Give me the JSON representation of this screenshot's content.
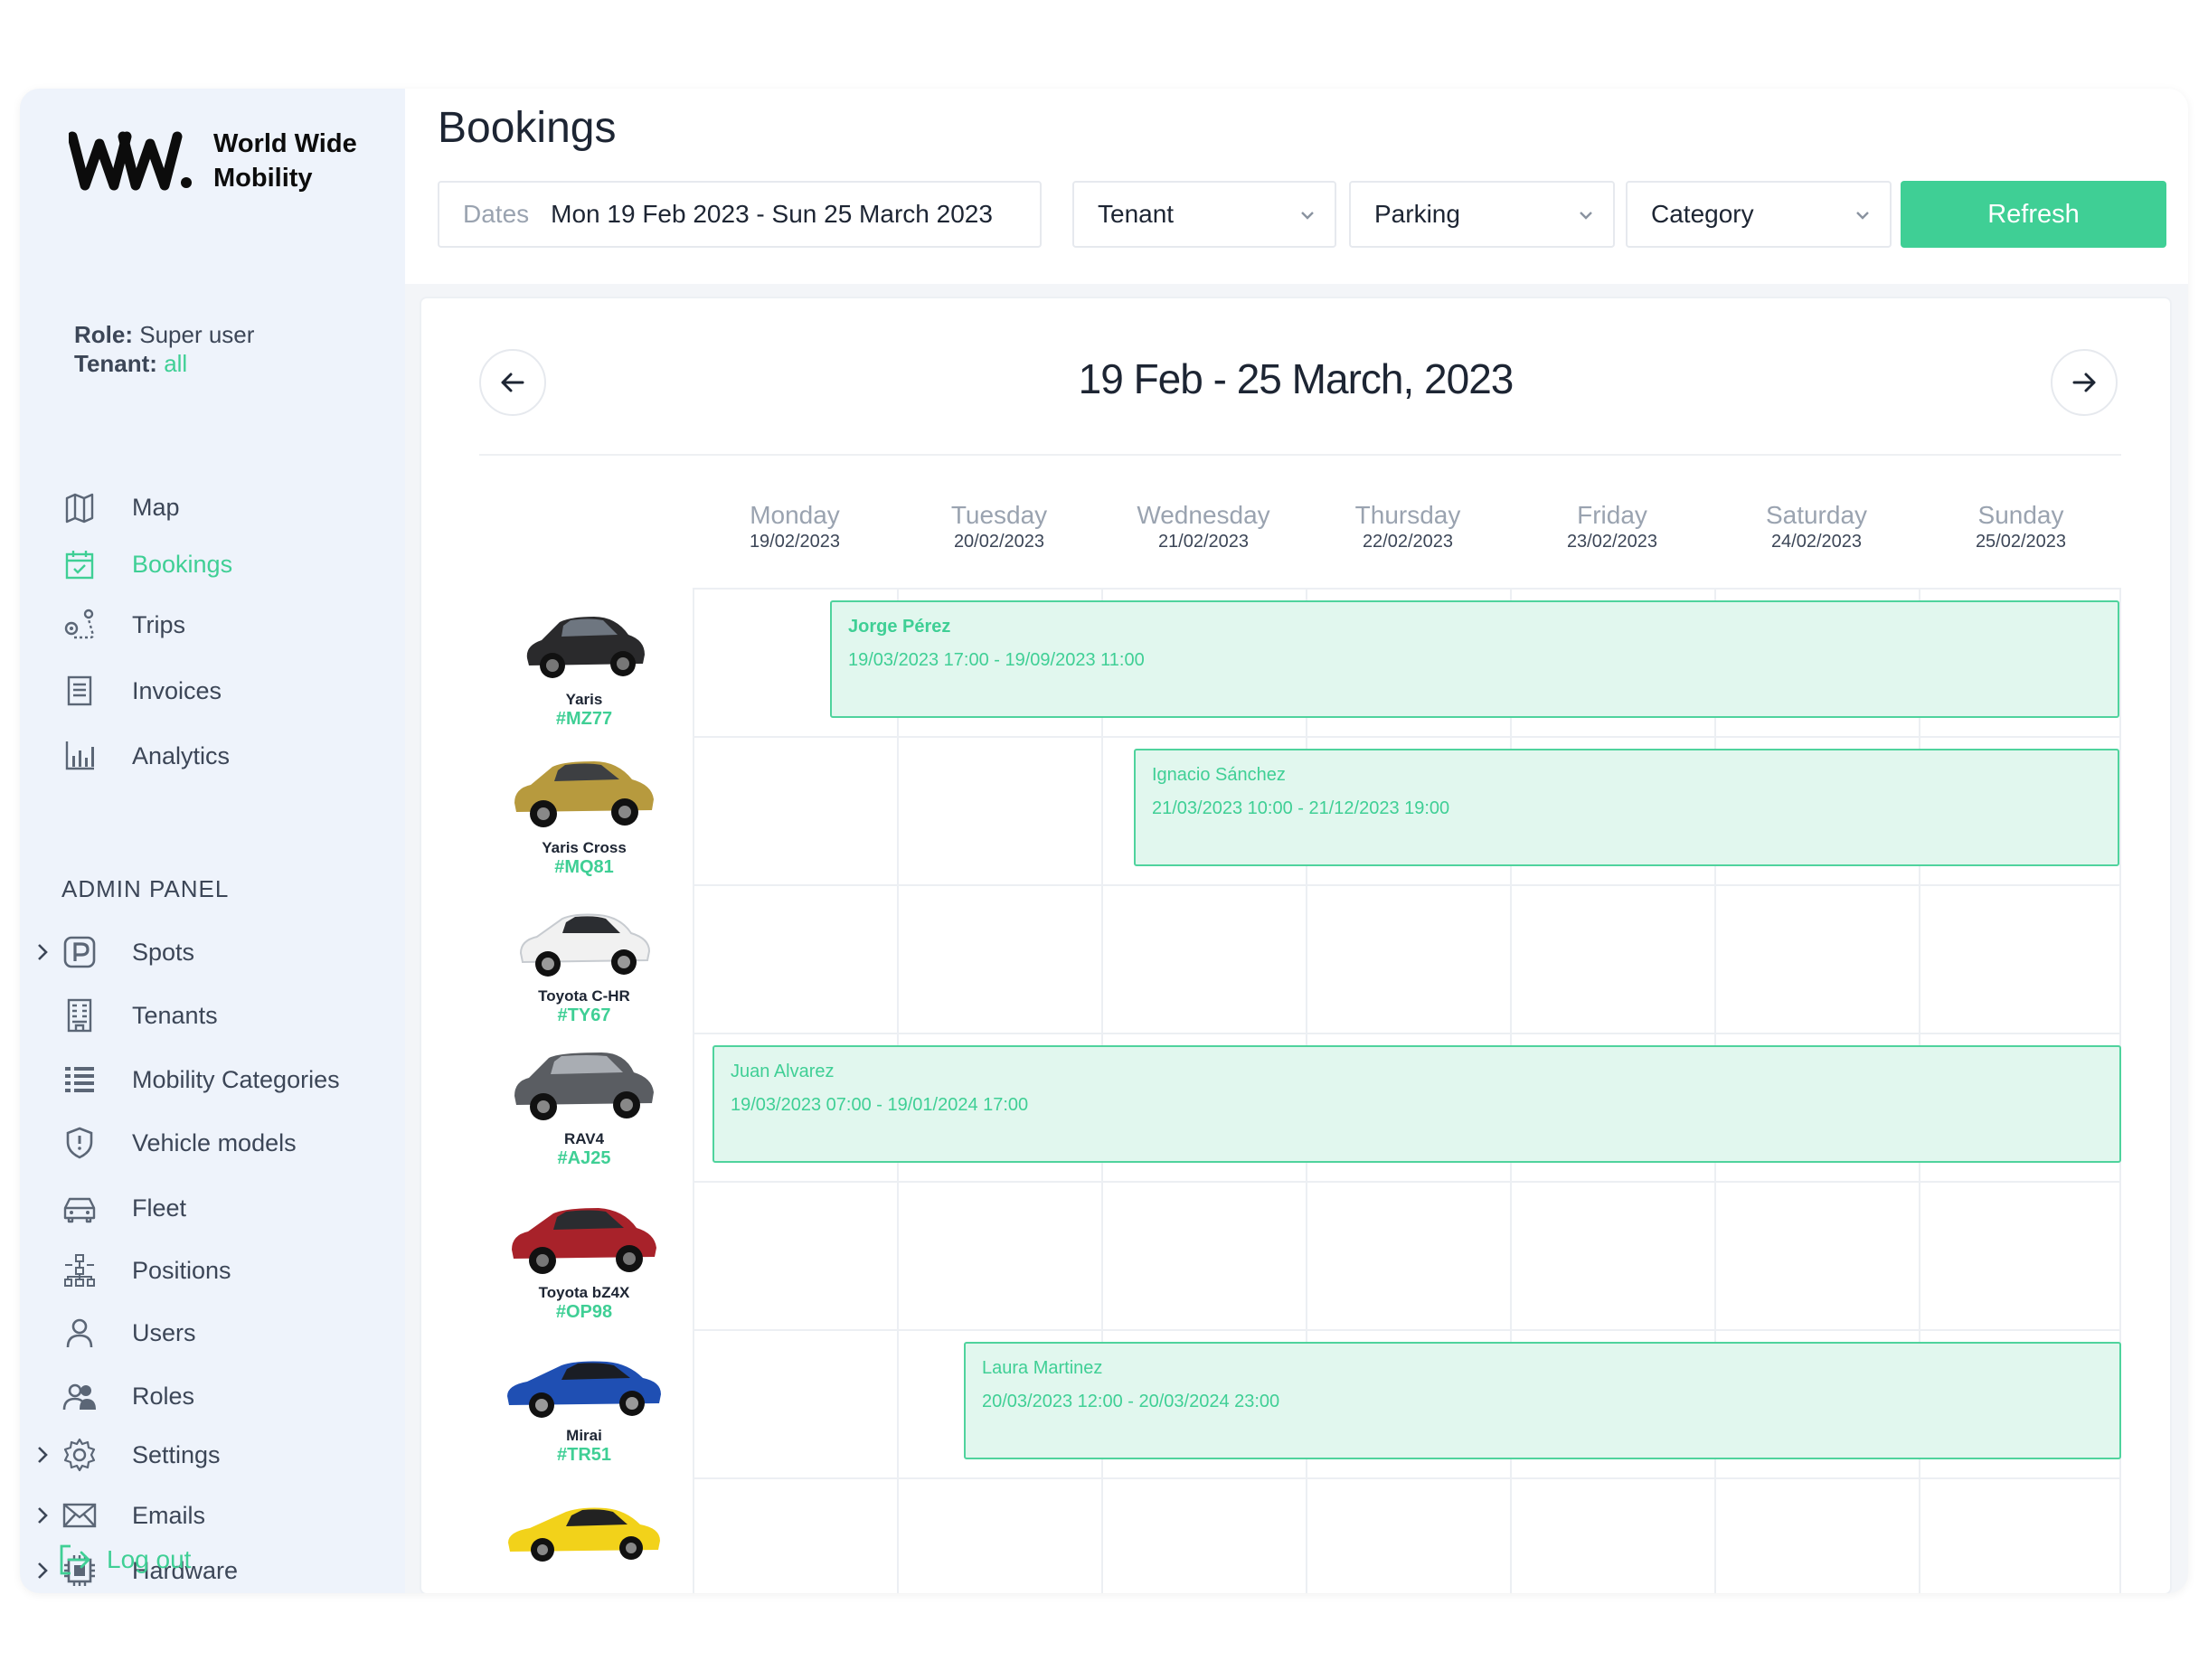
{
  "brand": {
    "mark": "W",
    "name_line1": "World Wide",
    "name_line2": "Mobility"
  },
  "role": {
    "role_key": "Role:",
    "role_value": "Super user",
    "tenant_key": "Tenant:",
    "tenant_value": "all"
  },
  "nav": [
    {
      "label": "Map",
      "icon": "map-icon"
    },
    {
      "label": "Bookings",
      "icon": "calendar-icon",
      "active": true
    },
    {
      "label": "Trips",
      "icon": "route-icon"
    },
    {
      "label": "Invoices",
      "icon": "invoice-icon"
    },
    {
      "label": "Analytics",
      "icon": "bar-chart-icon"
    }
  ],
  "admin": {
    "title": "ADMIN PANEL",
    "items": [
      {
        "label": "Spots",
        "icon": "parking-icon",
        "expandable": true
      },
      {
        "label": "Tenants",
        "icon": "building-icon"
      },
      {
        "label": "Mobility Categories",
        "icon": "list-icon"
      },
      {
        "label": "Vehicle models",
        "icon": "shield-icon"
      },
      {
        "label": "Fleet",
        "icon": "car-icon"
      },
      {
        "label": "Positions",
        "icon": "hierarchy-icon"
      },
      {
        "label": "Users",
        "icon": "user-icon"
      },
      {
        "label": "Roles",
        "icon": "users-icon"
      },
      {
        "label": "Settings",
        "icon": "gear-icon",
        "expandable": true
      },
      {
        "label": "Emails",
        "icon": "mail-icon",
        "expandable": true
      },
      {
        "label": "Hardware",
        "icon": "chip-icon",
        "expandable": true
      }
    ]
  },
  "logout": "Log out",
  "header": {
    "title": "Bookings",
    "dates_key": "Dates",
    "dates_value": "Mon 19 Feb 2023 - Sun 25 March 2023",
    "tenant": "Tenant",
    "parking": "Parking",
    "category": "Category",
    "refresh": "Refresh"
  },
  "calendar": {
    "range": "19 Feb - 25  March, 2023",
    "days": [
      {
        "name": "Monday",
        "date": "19/02/2023"
      },
      {
        "name": "Tuesday",
        "date": "20/02/2023"
      },
      {
        "name": "Wednesday",
        "date": "21/02/2023"
      },
      {
        "name": "Thursday",
        "date": "22/02/2023"
      },
      {
        "name": "Friday",
        "date": "23/02/2023"
      },
      {
        "name": "Saturday",
        "date": "24/02/2023"
      },
      {
        "name": "Sunday",
        "date": "25/02/2023"
      }
    ],
    "vehicles": [
      {
        "model": "Yaris",
        "plate": "#MZ77",
        "color": "#2a2a2c"
      },
      {
        "model": "Yaris Cross",
        "plate": "#MQ81",
        "color": "#b79a3e"
      },
      {
        "model": "Toyota C-HR",
        "plate": "#TY67",
        "color": "#f4f4f4"
      },
      {
        "model": "RAV4",
        "plate": "#AJ25",
        "color": "#5a5d62"
      },
      {
        "model": "Toyota bZ4X",
        "plate": "#OP98",
        "color": "#a8222a"
      },
      {
        "model": "Mirai",
        "plate": "#TR51",
        "color": "#1f4fb3"
      },
      {
        "model": "",
        "plate": "",
        "color": "#f2d21a"
      }
    ],
    "bookings": [
      {
        "name": "Jorge Pérez",
        "time": "19/03/2023 17:00 - 19/09/2023 11:00"
      },
      {
        "name": "Ignacio Sánchez",
        "time": "21/03/2023 10:00 - 21/12/2023 19:00"
      },
      {
        "name": "Juan Alvarez",
        "time": "19/03/2023 07:00 - 19/01/2024 17:00"
      },
      {
        "name": "Laura Martinez",
        "time": "20/03/2023 12:00 - 20/03/2024 23:00"
      }
    ]
  },
  "colors": {
    "accent": "#3fcf95",
    "booking_fill": "#e1f7ee",
    "sidebar_bg": "#eef3fb"
  }
}
